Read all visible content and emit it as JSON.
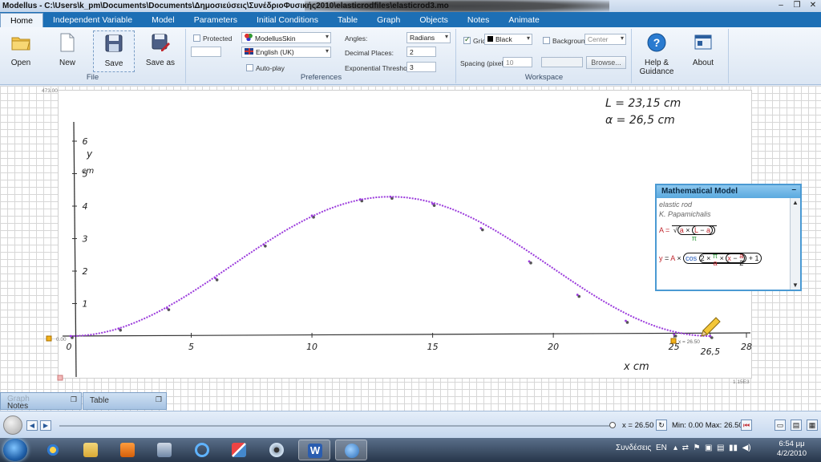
{
  "window": {
    "title": "Modellus - C:\\Users\\k_pm\\Documents\\Documents\\Δημοσιεύσεις\\ΣυνέδριοΦυσικής2010\\elasticrodfiles\\elasticrod3.modellus"
  },
  "tabs": [
    {
      "label": "Home",
      "active": true
    },
    {
      "label": "Independent Variable",
      "active": false
    },
    {
      "label": "Model",
      "active": false
    },
    {
      "label": "Parameters",
      "active": false
    },
    {
      "label": "Initial Conditions",
      "active": false
    },
    {
      "label": "Table",
      "active": false
    },
    {
      "label": "Graph",
      "active": false
    },
    {
      "label": "Objects",
      "active": false
    },
    {
      "label": "Notes",
      "active": false
    },
    {
      "label": "Animate",
      "active": false
    }
  ],
  "ribbon": {
    "file": {
      "group_label": "File",
      "open": "Open",
      "new": "New",
      "save": "Save",
      "save_as": "Save as"
    },
    "preferences": {
      "group_label": "Preferences",
      "protected": "Protected",
      "skin": "ModellusSkin",
      "language": "English (UK)",
      "autoplay": "Auto-play",
      "angles_label": "Angles:",
      "angles_value": "Radians",
      "decimal_label": "Decimal Places:",
      "decimal_value": "2",
      "exp_label": "Exponential Threshold:",
      "exp_value": "3"
    },
    "workspace": {
      "group_label": "Workspace",
      "grid": "Grid",
      "grid_color": "Black",
      "background": "Background",
      "background_pos": "Center",
      "spacing_label": "Spacing (pixels):",
      "spacing_value": "10",
      "browse": "Browse..."
    },
    "help": "Help & Guidance",
    "about": "About"
  },
  "graph": {
    "corner_top_left": "473.00",
    "corner_bottom_right": "1.15E3",
    "handwritten": {
      "line1": "L = 23,15 cm",
      "line2": "α = 26,5 cm",
      "y_axis_label": "y",
      "y_axis_unit": "cm",
      "x_axis_label": "x  cm",
      "x_ticks": [
        "0",
        "5",
        "10",
        "15",
        "20",
        "25",
        "26,5",
        "28"
      ],
      "y_ticks": [
        "1",
        "2",
        "3",
        "4",
        "5",
        "6"
      ]
    },
    "origin_label": "0.00",
    "point_label": "x = 26.50",
    "accent_color": "#9b3bdc"
  },
  "chart_data": {
    "type": "line",
    "xlabel": "x  cm",
    "ylabel": "y cm",
    "x": [
      0,
      2,
      4,
      6,
      8,
      10,
      12,
      13.25,
      15,
      17,
      19,
      21,
      23,
      25,
      26.5
    ],
    "values": [
      0,
      0.23,
      0.86,
      1.78,
      2.82,
      3.71,
      4.21,
      4.29,
      4.07,
      3.32,
      2.3,
      1.27,
      0.47,
      0.05,
      0
    ],
    "xlim": [
      0,
      28
    ],
    "ylim": [
      0,
      6
    ]
  },
  "model_window": {
    "title": "Mathematical Model",
    "note1": "elastic rod",
    "note2": "K. Papamichalis",
    "eq1": {
      "lhs": "A =",
      "a": "a",
      "times": "×",
      "L": "L",
      "minus": "−",
      "a2": "a",
      "pi": "π"
    },
    "eq2": {
      "y": "y",
      "eq": "=",
      "A": "A",
      "times": "×",
      "cos": "cos",
      "two": "2",
      "pi": "π",
      "a": "a",
      "x": "x",
      "minus": "−",
      "a2": "a",
      "two2": "2",
      "plus": "+",
      "one": "1"
    }
  },
  "dock": {
    "graph_tab": "Graph",
    "notes_tab": "Notes",
    "table_tab": "Table"
  },
  "animation": {
    "x_value": "x = 26.50",
    "min_max": "Min: 0.00  Max: 26.50",
    "progress": 1.0
  },
  "taskbar": {
    "connections": "Συνδέσεις",
    "lang": "EN",
    "time": "6:54 μμ",
    "date": "4/2/2010"
  }
}
